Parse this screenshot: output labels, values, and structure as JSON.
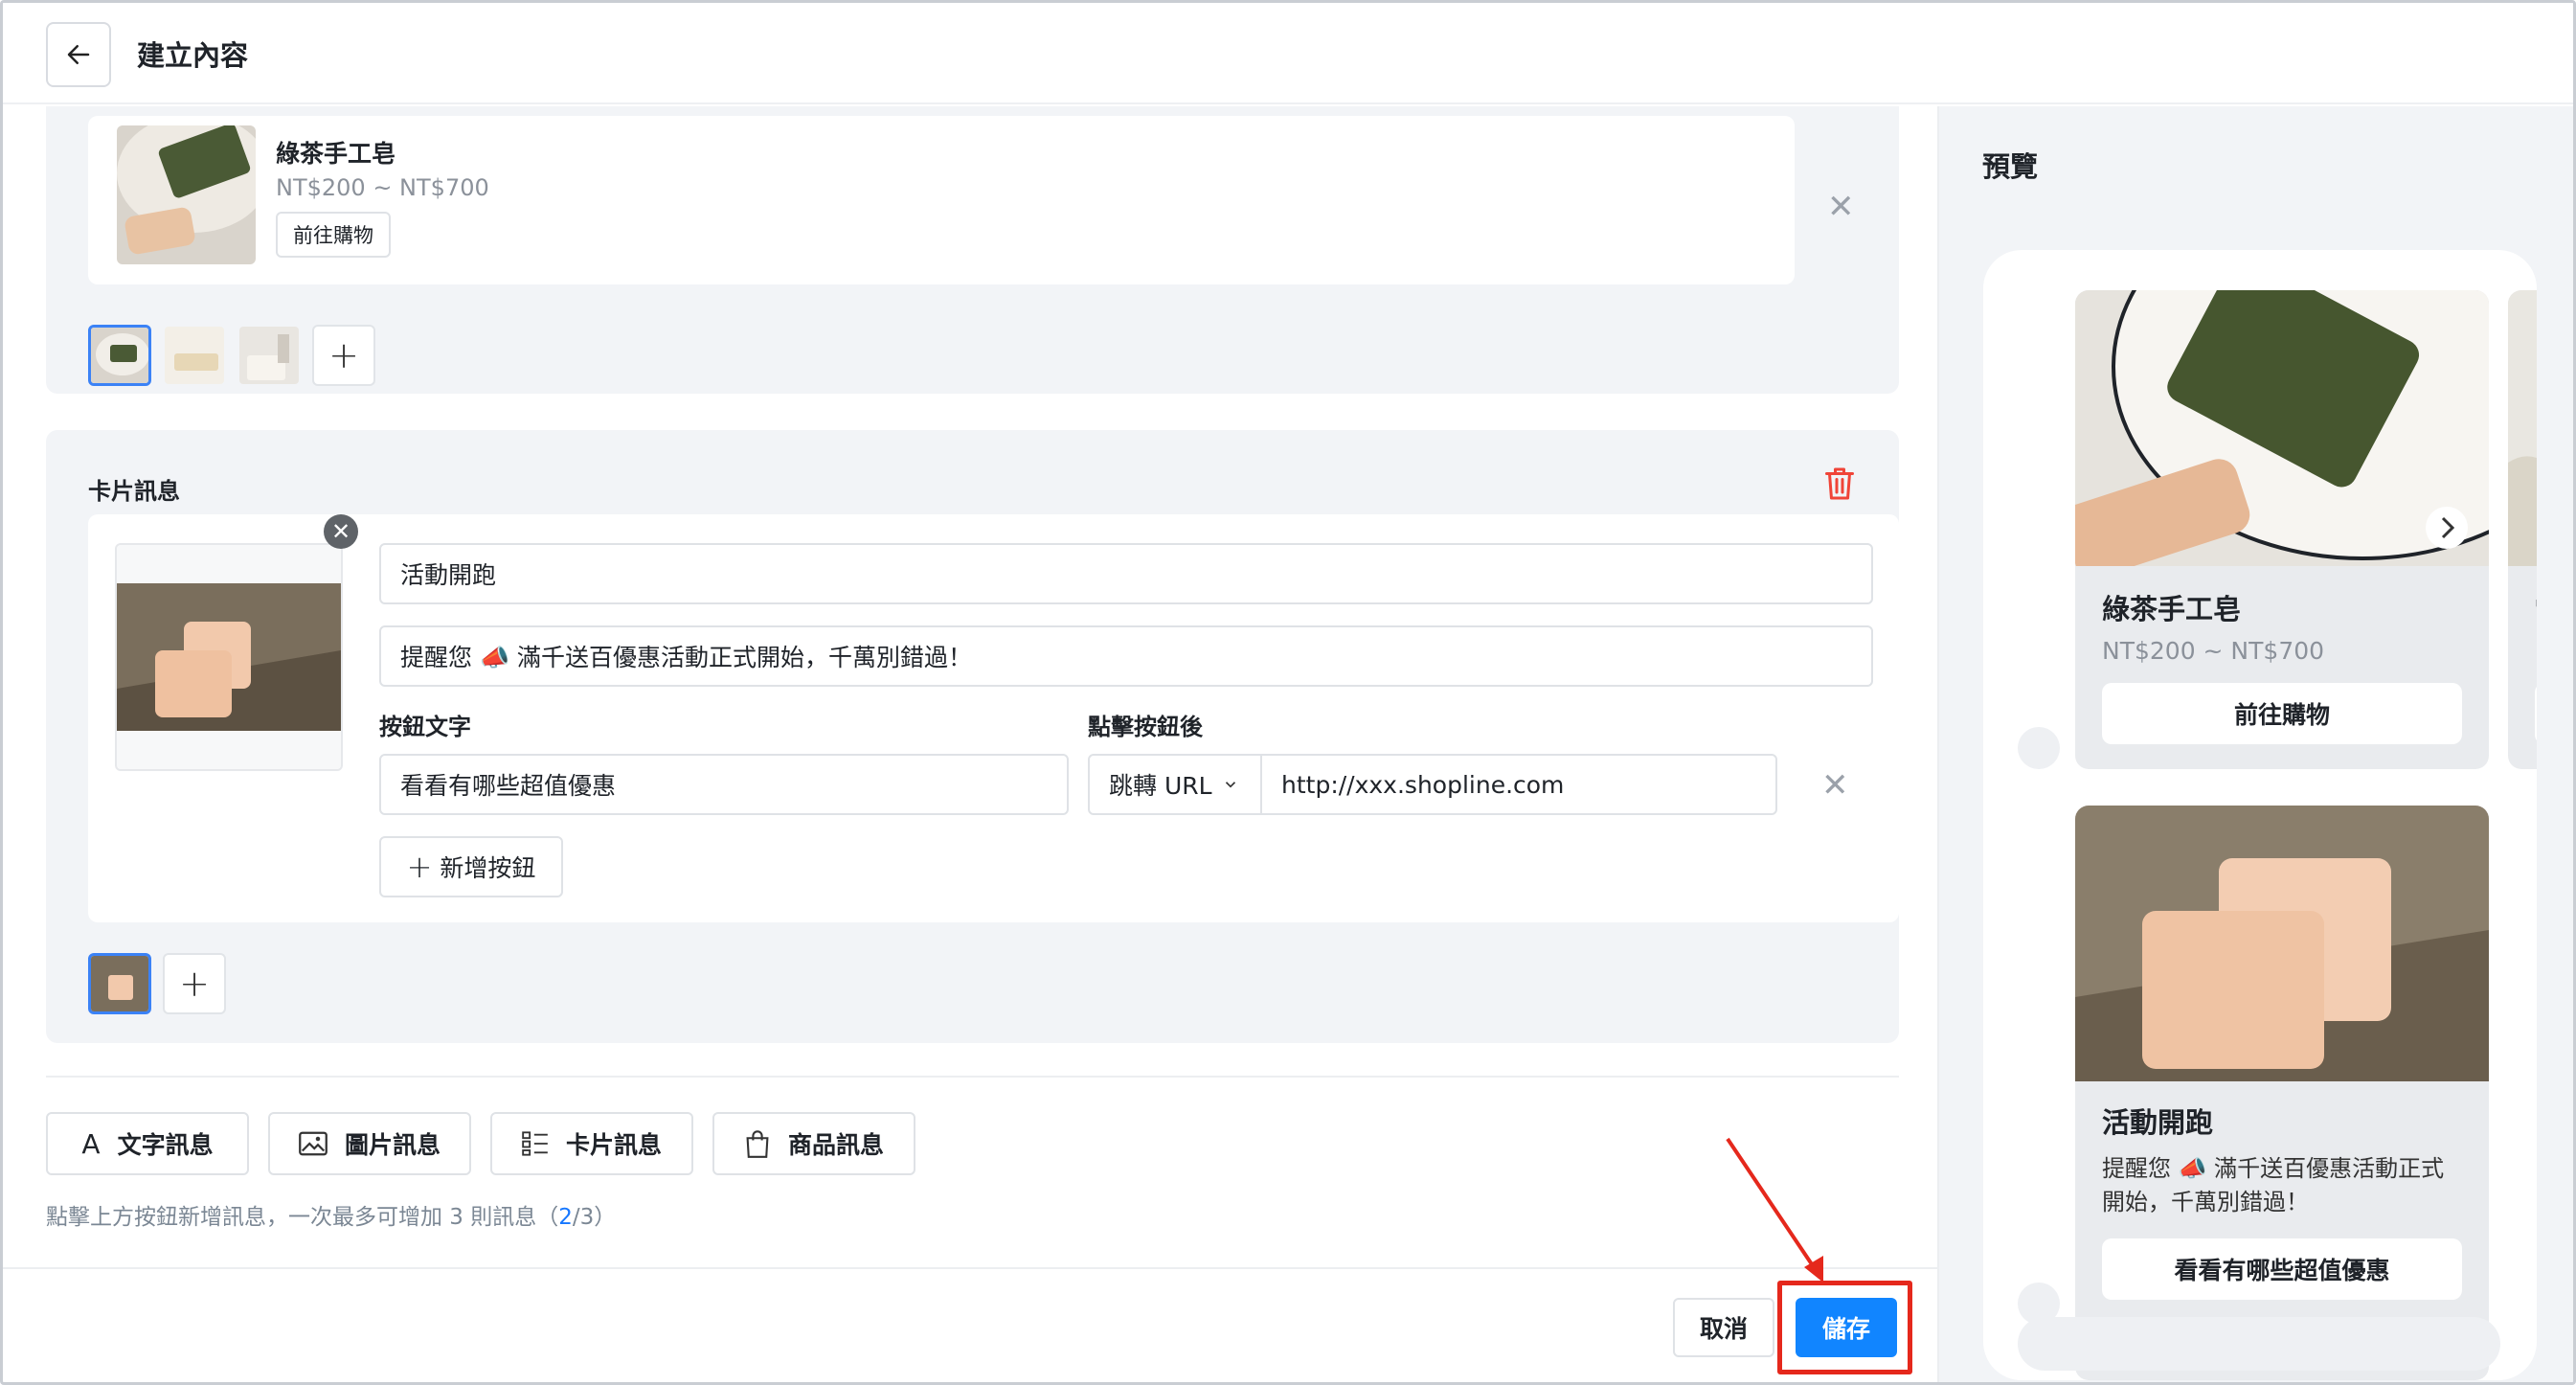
{
  "header": {
    "title": "建立內容"
  },
  "product_section": {
    "product": {
      "name": "綠茶手工皂",
      "price": "NT$200 ~ NT$700",
      "button": "前往購物"
    }
  },
  "card_section": {
    "title": "卡片訊息",
    "card": {
      "title_value": "活動開跑",
      "description_value": "提醒您 📣 滿千送百優惠活動正式開始，千萬別錯過！",
      "button_text_label": "按鈕文字",
      "after_click_label": "點擊按鈕後",
      "button_text_value": "看看有哪些超值優惠",
      "action_type": "跳轉 URL",
      "url_value": "http://xxx.shopline.com",
      "add_button": "新增按鈕"
    }
  },
  "message_types": {
    "text": "文字訊息",
    "image": "圖片訊息",
    "card": "卡片訊息",
    "product": "商品訊息"
  },
  "hint": {
    "prefix": "點擊上方按鈕新增訊息，一次最多可增加 3 則訊息（",
    "count": "2",
    "suffix": "/3）"
  },
  "footer": {
    "cancel": "取消",
    "save": "儲存"
  },
  "preview": {
    "title": "預覽",
    "product_card": {
      "name": "綠茶手工皂",
      "price": "NT$200 ~ NT$700",
      "button": "前往購物"
    },
    "promo_card": {
      "title": "活動開跑",
      "text": "提醒您 📣 滿千送百優惠活動正式開始，千萬別錯過！",
      "button": "看看有哪些超值優惠"
    },
    "partial_card": {
      "name_initial": "雪",
      "price_initial": "N"
    }
  },
  "colors": {
    "primary": "#1185ff",
    "highlight": "#e5281c",
    "danger": "#f04438"
  }
}
